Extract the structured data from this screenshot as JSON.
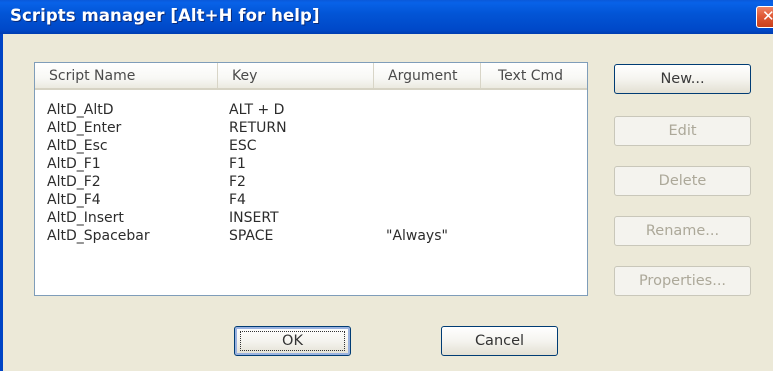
{
  "window": {
    "title": "Scripts manager [Alt+H for help]",
    "close_glyph": "✕"
  },
  "list": {
    "columns": [
      "Script Name",
      "Key",
      "Argument",
      "Text Cmd"
    ],
    "rows": [
      {
        "name": "AltD_AltD",
        "key": "ALT + D",
        "argument": "",
        "text_cmd": ""
      },
      {
        "name": "AltD_Enter",
        "key": "RETURN",
        "argument": "",
        "text_cmd": ""
      },
      {
        "name": "AltD_Esc",
        "key": "ESC",
        "argument": "",
        "text_cmd": ""
      },
      {
        "name": "AltD_F1",
        "key": "F1",
        "argument": "",
        "text_cmd": ""
      },
      {
        "name": "AltD_F2",
        "key": "F2",
        "argument": "",
        "text_cmd": ""
      },
      {
        "name": "AltD_F4",
        "key": "F4",
        "argument": "",
        "text_cmd": ""
      },
      {
        "name": "AltD_Insert",
        "key": "INSERT",
        "argument": "",
        "text_cmd": ""
      },
      {
        "name": "AltD_Spacebar",
        "key": "SPACE",
        "argument": "\"Always\"",
        "text_cmd": ""
      }
    ]
  },
  "side_buttons": {
    "new": "New...",
    "edit": "Edit",
    "delete": "Delete",
    "rename": "Rename...",
    "properties": "Properties..."
  },
  "bottom_buttons": {
    "ok": "OK",
    "cancel": "Cancel"
  },
  "colors": {
    "titlebar": "#0255d6",
    "dialog_bg": "#ece9d8",
    "disabled_text": "#aca899"
  }
}
